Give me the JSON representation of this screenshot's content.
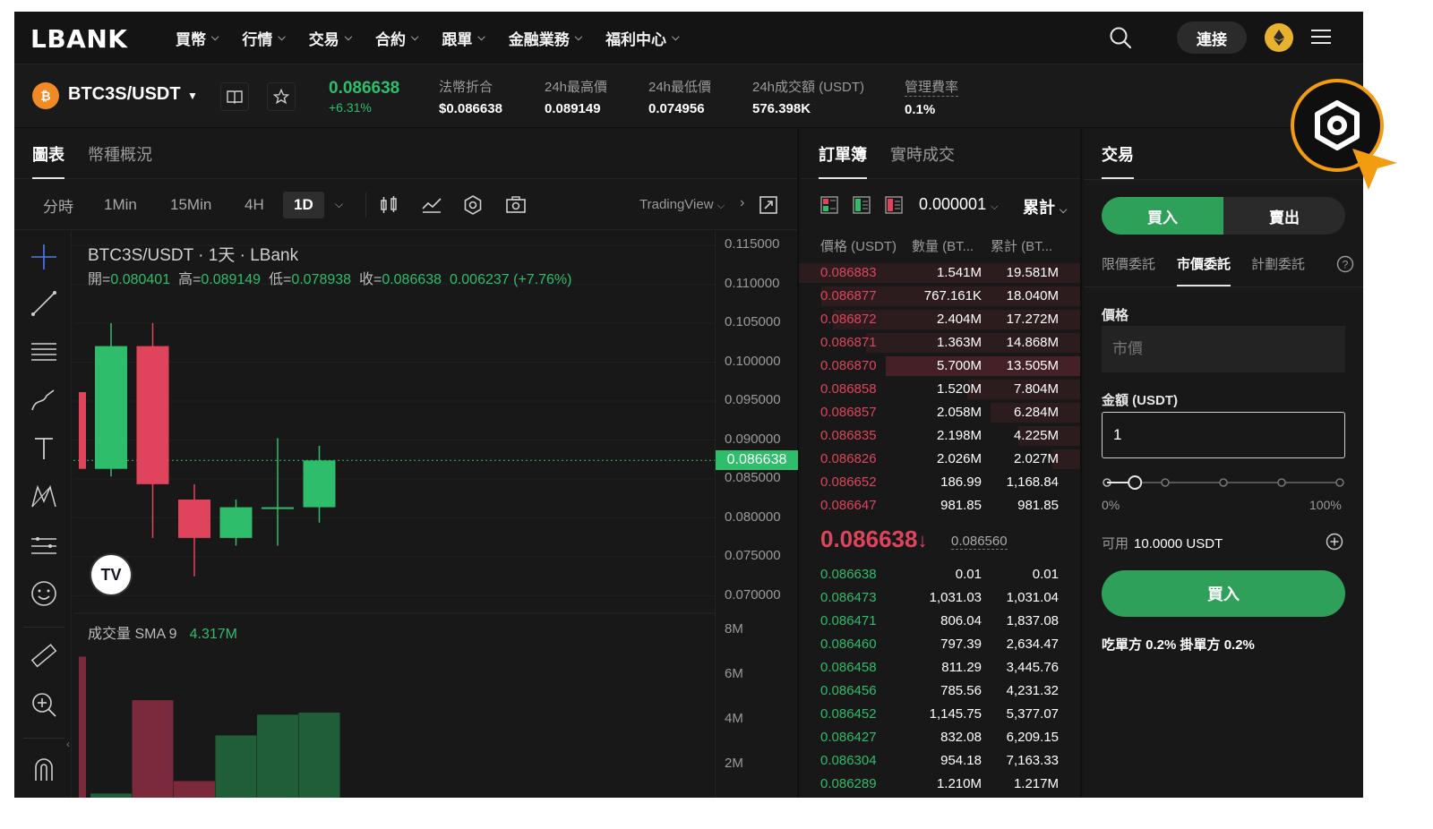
{
  "nav": {
    "logo": "LBANK",
    "menu": [
      "買幣",
      "行情",
      "交易",
      "合約",
      "跟單",
      "金融業務",
      "福利中心"
    ],
    "connect_label": "連接"
  },
  "ticker": {
    "coin_badge": "₿",
    "pair": "BTC3S/USDT",
    "last_price": "0.086638",
    "change_pct": "+6.31%",
    "stats": [
      {
        "label": "法幣折合",
        "value": "$0.086638"
      },
      {
        "label": "24h最高價",
        "value": "0.089149"
      },
      {
        "label": "24h最低價",
        "value": "0.074956"
      },
      {
        "label": "24h成交額 (USDT)",
        "value": "576.398K"
      },
      {
        "label": "管理費率",
        "value": "0.1%"
      }
    ]
  },
  "chart": {
    "tabs": [
      "圖表",
      "幣種概況"
    ],
    "timeframes": [
      "分時",
      "1Min",
      "15Min",
      "4H",
      "1D"
    ],
    "active_timeframe": "1D",
    "tradingview_label": "TradingView",
    "title": "BTC3S/USDT · 1天 · LBank",
    "ohlc": {
      "open_label": "開=",
      "open": "0.080401",
      "high_label": "高=",
      "high": "0.089149",
      "low_label": "低=",
      "low": "0.078938",
      "close_label": "收=",
      "close": "0.086638",
      "change": "0.006237 (+7.76%)"
    },
    "volume_label": "成交量 SMA 9",
    "volume_value": "4.317M",
    "tv_badge": "TV",
    "price_axis": [
      "0.115000",
      "0.110000",
      "0.105000",
      "0.100000",
      "0.095000",
      "0.090000",
      "0.085000",
      "0.080000",
      "0.075000",
      "0.070000"
    ],
    "current_price_tag": "0.086638",
    "volume_axis": [
      "8M",
      "6M",
      "4M",
      "2M"
    ]
  },
  "chart_data": {
    "type": "candlestick",
    "title": "BTC3S/USDT · 1天 · LBank",
    "ylim": [
      0.0675,
      0.1165
    ],
    "candles": [
      {
        "open": 0.0955,
        "high": 0.0955,
        "low": 0.0855,
        "close": 0.0855,
        "color": "red"
      },
      {
        "open": 0.0855,
        "high": 0.1045,
        "low": 0.0845,
        "close": 0.1015,
        "color": "green"
      },
      {
        "open": 0.1015,
        "high": 0.1045,
        "low": 0.0765,
        "close": 0.0835,
        "color": "red"
      },
      {
        "open": 0.0815,
        "high": 0.0835,
        "low": 0.0715,
        "close": 0.0765,
        "color": "red"
      },
      {
        "open": 0.0765,
        "high": 0.0815,
        "low": 0.0755,
        "close": 0.0805,
        "color": "green"
      },
      {
        "open": 0.0805,
        "high": 0.0895,
        "low": 0.0755,
        "close": 0.0805,
        "color": "green"
      },
      {
        "open": 0.0805,
        "high": 0.0885,
        "low": 0.0785,
        "close": 0.0866,
        "color": "green"
      }
    ],
    "volume": {
      "ylim": [
        0,
        8500000
      ],
      "values": [
        6800000,
        200000,
        4700000,
        800000,
        3000000,
        4000000,
        4100000
      ],
      "colors": [
        "red",
        "green",
        "red",
        "red",
        "green",
        "green",
        "green"
      ]
    }
  },
  "orderbook": {
    "tabs": [
      "訂單簿",
      "實時成交"
    ],
    "precision": "0.000001",
    "cum_label": "累計",
    "headers": [
      "價格 (USDT)",
      "數量 (BT...",
      "累計 (BT..."
    ],
    "asks": [
      {
        "price": "0.086883",
        "qty": "1.541M",
        "cum": "19.581M",
        "depth": 1.0
      },
      {
        "price": "0.086877",
        "qty": "767.161K",
        "cum": "18.040M",
        "depth": 0.92
      },
      {
        "price": "0.086872",
        "qty": "2.404M",
        "cum": "17.272M",
        "depth": 0.88
      },
      {
        "price": "0.086871",
        "qty": "1.363M",
        "cum": "14.868M",
        "depth": 0.76
      },
      {
        "price": "0.086870",
        "qty": "5.700M",
        "cum": "13.505M",
        "depth": 0.69
      },
      {
        "price": "0.086858",
        "qty": "1.520M",
        "cum": "7.804M",
        "depth": 0.4
      },
      {
        "price": "0.086857",
        "qty": "2.058M",
        "cum": "6.284M",
        "depth": 0.32
      },
      {
        "price": "0.086835",
        "qty": "2.198M",
        "cum": "4.225M",
        "depth": 0.22
      },
      {
        "price": "0.086826",
        "qty": "2.026M",
        "cum": "2.027M",
        "depth": 0.1
      },
      {
        "price": "0.086652",
        "qty": "186.99",
        "cum": "1,168.84",
        "depth": 0.0
      },
      {
        "price": "0.086647",
        "qty": "981.85",
        "cum": "981.85",
        "depth": 0.0
      }
    ],
    "mid_price": "0.086638",
    "mid_arrow": "↓",
    "mark_price": "0.086560",
    "bids": [
      {
        "price": "0.086638",
        "qty": "0.01",
        "cum": "0.01"
      },
      {
        "price": "0.086473",
        "qty": "1,031.03",
        "cum": "1,031.04"
      },
      {
        "price": "0.086471",
        "qty": "806.04",
        "cum": "1,837.08"
      },
      {
        "price": "0.086460",
        "qty": "797.39",
        "cum": "2,634.47"
      },
      {
        "price": "0.086458",
        "qty": "811.29",
        "cum": "3,445.76"
      },
      {
        "price": "0.086456",
        "qty": "785.56",
        "cum": "4,231.32"
      },
      {
        "price": "0.086452",
        "qty": "1,145.75",
        "cum": "5,377.07"
      },
      {
        "price": "0.086427",
        "qty": "832.08",
        "cum": "6,209.15"
      },
      {
        "price": "0.086304",
        "qty": "954.18",
        "cum": "7,163.33"
      },
      {
        "price": "0.086289",
        "qty": "1.210M",
        "cum": "1.217M"
      }
    ]
  },
  "trade": {
    "tab": "交易",
    "buy_tab": "買入",
    "sell_tab": "賣出",
    "order_types": [
      "限價委託",
      "市價委託",
      "計劃委託"
    ],
    "active_order_type": "市價委託",
    "price_label": "價格",
    "price_placeholder": "市價",
    "amount_label": "金額 (USDT)",
    "amount_value": "1",
    "slider_min": "0%",
    "slider_max": "100%",
    "slider_fraction": 0.12,
    "available_label": "可用",
    "available_value": "10.0000 USDT",
    "buy_button": "買入",
    "fees": "吃單方 0.2%  掛單方 0.2%"
  },
  "colors": {
    "up": "#2ebd6b",
    "down": "#e0445c",
    "highlight": "#f39c12"
  }
}
